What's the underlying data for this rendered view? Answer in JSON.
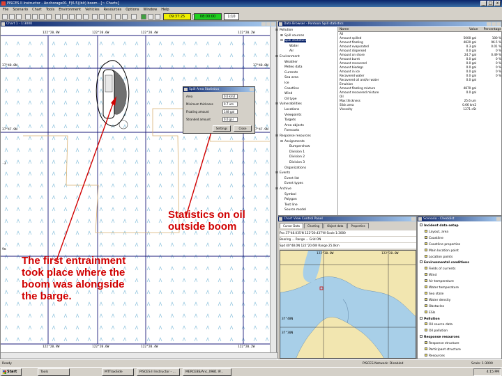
{
  "window": {
    "title": "PISCES II Instructor - Anchorage01_F(6.5)(bit) boom - [~ Charts]",
    "buttons": [
      "_",
      "□",
      "x"
    ]
  },
  "menu": [
    "File",
    "Scenario",
    "Chart",
    "Tools",
    "Environment",
    "Vehicles",
    "Resources",
    "Options",
    "Window",
    "Help"
  ],
  "toolbar": {
    "time1": "09:37:25",
    "time2": "08:00:00",
    "speed": "1:10"
  },
  "chart_window": {
    "title": "Chart 1 - 1:3000",
    "top_lons": [
      "122°20.8W",
      "122°20.6W",
      "122°20.4W",
      "122°20.2W"
    ],
    "bottom_lons": [
      "122°20.8W",
      "122°20.6W",
      "122°20.4W",
      "122°20.2W"
    ],
    "left_lats": [
      "37°48.0N",
      "37°47.9N"
    ],
    "right_lats": [
      "37°48.0N",
      "37°47.9N"
    ],
    "edge_marks": [
      "-3",
      "9m"
    ]
  },
  "dialog": {
    "title": "Spill Area Statistics",
    "rows": [
      {
        "label": "Area",
        "value": "0.6 km2"
      },
      {
        "label": "Minimum thickness",
        "value": "0.7 um"
      },
      {
        "label": "Floating amount",
        "value": "148 gal"
      },
      {
        "label": "Stranded amount",
        "value": "0.0 gal"
      }
    ],
    "btn_settings": "Settings",
    "btn_close": "Close"
  },
  "data_browser": {
    "title": "Data Browser - Pontoon Spill statistics",
    "tree": [
      {
        "label": "Pollution",
        "sign": "⊟",
        "sel": false
      },
      {
        "label": "Spill sources",
        "sign": "⊞",
        "sel": false
      },
      {
        "label": "Spill statistics",
        "sign": "⊟",
        "sel": true
      },
      {
        "label": "Water",
        "sign": "",
        "sel": false
      },
      {
        "label": "Air",
        "sign": "",
        "sel": false
      },
      {
        "label": "Environment",
        "sign": "⊟",
        "sel": false
      },
      {
        "label": "Weather",
        "sign": "",
        "sel": false
      },
      {
        "label": "Meteo data",
        "sign": "",
        "sel": false
      },
      {
        "label": "Currents",
        "sign": "",
        "sel": false
      },
      {
        "label": "Sea area",
        "sign": "",
        "sel": false
      },
      {
        "label": "Ice",
        "sign": "",
        "sel": false
      },
      {
        "label": "Coastline",
        "sign": "",
        "sel": false
      },
      {
        "label": "Wind",
        "sign": "",
        "sel": false
      },
      {
        "label": "Oil type",
        "sign": "",
        "sel": false
      },
      {
        "label": "Vulnerabilities",
        "sign": "⊟",
        "sel": false
      },
      {
        "label": "Locations",
        "sign": "",
        "sel": false
      },
      {
        "label": "Viewpoints",
        "sign": "",
        "sel": false
      },
      {
        "label": "Targets",
        "sign": "",
        "sel": false
      },
      {
        "label": "Area objects",
        "sign": "",
        "sel": false
      },
      {
        "label": "Forecasts",
        "sign": "",
        "sel": false
      },
      {
        "label": "Response resources",
        "sign": "⊟",
        "sel": false
      },
      {
        "label": "Assignments",
        "sign": "⊟",
        "sel": false
      },
      {
        "label": "Bumpershow",
        "sign": "",
        "sel": false
      },
      {
        "label": "Division 1",
        "sign": "",
        "sel": false
      },
      {
        "label": "Division 2",
        "sign": "",
        "sel": false
      },
      {
        "label": "Division 3",
        "sign": "",
        "sel": false
      },
      {
        "label": "Organizations",
        "sign": "",
        "sel": false
      },
      {
        "label": "Events",
        "sign": "⊟",
        "sel": false
      },
      {
        "label": "Event list",
        "sign": "",
        "sel": false
      },
      {
        "label": "Event types",
        "sign": "",
        "sel": false
      },
      {
        "label": "Archive",
        "sign": "⊟",
        "sel": false
      },
      {
        "label": "Symbol",
        "sign": "",
        "sel": false
      },
      {
        "label": "Polygon",
        "sign": "",
        "sel": false
      },
      {
        "label": "Text line",
        "sign": "",
        "sel": false
      },
      {
        "label": "Source model",
        "sign": "",
        "sel": false
      }
    ],
    "columns": {
      "name": "Name",
      "value": "Value",
      "percent": "Percentage"
    },
    "rows": [
      {
        "name": "All",
        "value": "",
        "pct": ""
      },
      {
        "name": "Amount spilled",
        "value": "5000 gal",
        "pct": "100 %"
      },
      {
        "name": "Amount floating",
        "value": "4820 gal",
        "pct": "96.5 %"
      },
      {
        "name": "Amount evaporated",
        "value": "0.3 gal",
        "pct": "0.01 %"
      },
      {
        "name": "Amount dispersed",
        "value": "0.0 gal",
        "pct": "0 %"
      },
      {
        "name": "Amount on shore",
        "value": "24.7 gal",
        "pct": "0.49 %"
      },
      {
        "name": "Amount burnt",
        "value": "0.0 gal",
        "pct": "0 %"
      },
      {
        "name": "Amount recovered",
        "value": "0.0 gal",
        "pct": "0 %"
      },
      {
        "name": "Amount biodegr.",
        "value": "0.0 gal",
        "pct": "0 %"
      },
      {
        "name": "Amount in ice",
        "value": "0.0 gal",
        "pct": "0 %"
      },
      {
        "name": "Recovered water",
        "value": "0.0 gal",
        "pct": "0 %"
      },
      {
        "name": "Recovered oil and/or water",
        "value": "0.0 gal",
        "pct": ""
      },
      {
        "name": "Emulsion",
        "value": "",
        "pct": ""
      },
      {
        "name": "Amount floating mixture",
        "value": "4870 gal",
        "pct": ""
      },
      {
        "name": "Amount recovered mixture",
        "value": "0.0 gal",
        "pct": ""
      },
      {
        "name": "Oil",
        "value": "",
        "pct": ""
      },
      {
        "name": "Max thickness",
        "value": "25.6 um",
        "pct": ""
      },
      {
        "name": "Slick area",
        "value": "0.66 km2",
        "pct": ""
      },
      {
        "name": "Viscosity",
        "value": "1271 cSt",
        "pct": ""
      }
    ]
  },
  "map_control": {
    "title": "Chart View Control Panel",
    "tabs": [
      "Cursor Data",
      "Charting",
      "Object data",
      "Properties"
    ],
    "rows": [
      "Pos  37°48.035'N  122°20.437'W   Scale  1:3000",
      "Bearing  ...   Range  ...   Grid  ON",
      "Spd  40°48.0N  122°20.6W   Range 25.0km"
    ],
    "map_lons": [
      "122°30.0W",
      "122°20.0W"
    ],
    "map_lats": [
      "37°48N",
      "37°30N"
    ]
  },
  "scenario": {
    "title": "Scenario - Checklist",
    "items": [
      {
        "label": "Incident data setup",
        "group": true
      },
      {
        "label": "Layout, area",
        "group": false
      },
      {
        "label": "Coastline",
        "group": false
      },
      {
        "label": "Coastline properties",
        "group": false
      },
      {
        "label": "Main location point",
        "group": false
      },
      {
        "label": "Location points",
        "group": false
      },
      {
        "label": "Environmental conditions",
        "group": true
      },
      {
        "label": "Fields of currents",
        "group": false
      },
      {
        "label": "Wind",
        "group": false
      },
      {
        "label": "Air temperature",
        "group": false
      },
      {
        "label": "Water temperature",
        "group": false
      },
      {
        "label": "Sea state",
        "group": false
      },
      {
        "label": "Water density",
        "group": false
      },
      {
        "label": "Obstacles",
        "group": false
      },
      {
        "label": "ESIs",
        "group": false
      },
      {
        "label": "Pollution",
        "group": true
      },
      {
        "label": "Oil source data",
        "group": false
      },
      {
        "label": "Oil pollution",
        "group": false
      },
      {
        "label": "Response resources",
        "group": true
      },
      {
        "label": "Response structure",
        "group": false
      },
      {
        "label": "Participant structure",
        "group": false
      },
      {
        "label": "Resources",
        "group": false
      }
    ]
  },
  "status": {
    "left": "Ready",
    "center": "PISCES Network: Disabled",
    "right": "Scale: 1:3000"
  },
  "taskbar": {
    "start": "Start",
    "items": [
      "Tools",
      "MTTraxSide",
      "PISCES II Instructor - ...",
      "MERCEBS/Anc_0981 IP..."
    ],
    "clock": "4:15 PM"
  },
  "annotations": {
    "stats_line1": "Statistics on oil",
    "stats_line2": "outside boom",
    "entrain_lines": [
      "The first entrainment",
      "took place where the",
      "boom was alongside",
      "the barge."
    ]
  },
  "colors": {
    "annotation": "#d00000",
    "grid": "#1a1a7a",
    "current_arrows": "#7ab8d8",
    "range_box": "#d8b070",
    "land": "#f2e6b0",
    "water": "#a8cfe8"
  }
}
